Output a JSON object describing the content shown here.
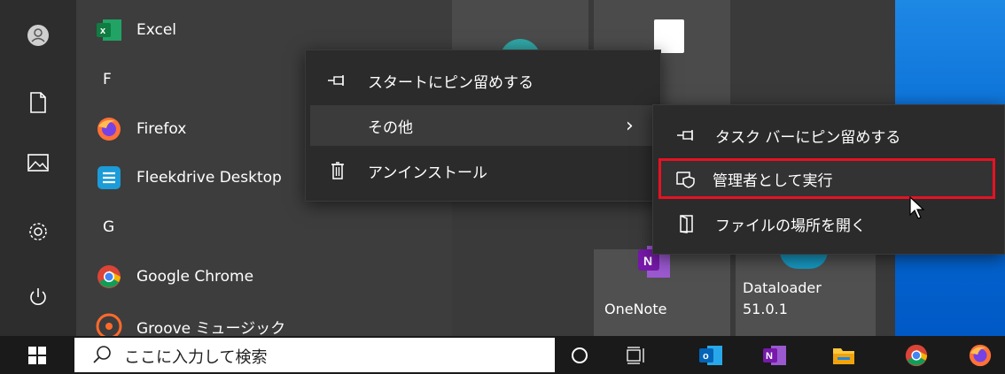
{
  "rail": {
    "items": [
      {
        "icon": "user-icon"
      },
      {
        "icon": "document-icon"
      },
      {
        "icon": "pictures-icon"
      },
      {
        "icon": "settings-icon"
      },
      {
        "icon": "power-icon"
      }
    ]
  },
  "app_list": {
    "items": [
      {
        "type": "app",
        "label": "Excel",
        "icon": "excel-icon"
      },
      {
        "type": "letter",
        "label": "F"
      },
      {
        "type": "app",
        "label": "Firefox",
        "icon": "firefox-icon"
      },
      {
        "type": "app",
        "label": "Fleekdrive Desktop",
        "icon": "fleekdrive-icon"
      },
      {
        "type": "letter",
        "label": "G"
      },
      {
        "type": "app",
        "label": "Google Chrome",
        "icon": "chrome-icon"
      },
      {
        "type": "app",
        "label": "Groove ミュージック",
        "icon": "groove-icon"
      }
    ]
  },
  "tiles": {
    "onenote": {
      "label": "OneNote"
    },
    "dataloader": {
      "label": "Dataloader",
      "sublabel": "51.0.1"
    }
  },
  "context_menu": {
    "items": [
      {
        "label": "スタートにピン留めする",
        "icon": "pin-icon"
      },
      {
        "label": "その他",
        "icon": "",
        "chevron": "›"
      },
      {
        "label": "アンインストール",
        "icon": "trash-icon"
      }
    ]
  },
  "submenu": {
    "items": [
      {
        "label": "タスク バーにピン留めする",
        "icon": "pin-icon"
      },
      {
        "label": "管理者として実行",
        "icon": "run-as-admin-icon",
        "highlighted": true
      },
      {
        "label": "ファイルの場所を開く",
        "icon": "open-file-location-icon"
      }
    ],
    "highlight_color": "#e81123"
  },
  "taskbar": {
    "search_placeholder": "ここに入力して検索",
    "buttons": [
      {
        "icon": "windows-start-icon"
      },
      {
        "icon": "cortana-icon"
      },
      {
        "icon": "task-view-icon"
      },
      {
        "icon": "outlook-icon"
      },
      {
        "icon": "onenote-icon"
      },
      {
        "icon": "file-explorer-icon"
      },
      {
        "icon": "chrome-icon"
      },
      {
        "icon": "firefox-icon"
      }
    ]
  }
}
